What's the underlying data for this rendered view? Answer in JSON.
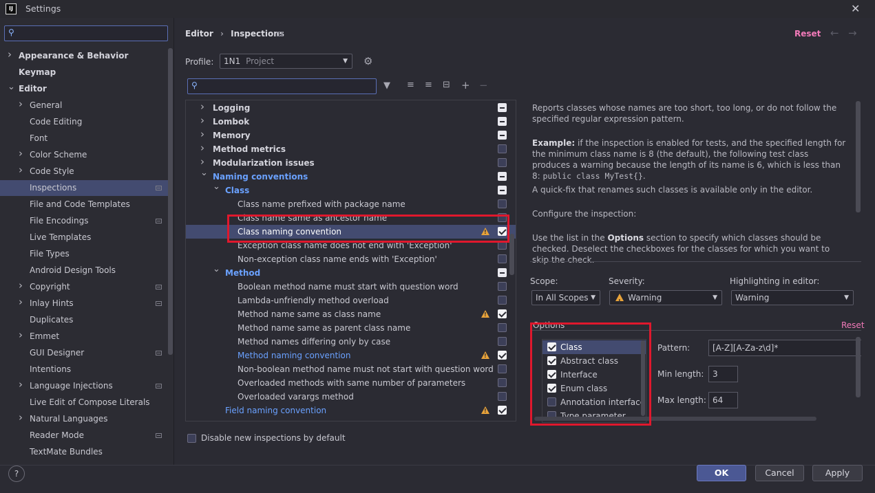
{
  "window": {
    "title": "Settings",
    "app_logo": "IJ"
  },
  "sidebar": {
    "search_placeholder": "",
    "items": [
      {
        "label": "Appearance & Behavior",
        "bold": true,
        "chevron": "right",
        "indent": 0
      },
      {
        "label": "Keymap",
        "bold": true,
        "chevron": "",
        "indent": 0
      },
      {
        "label": "Editor",
        "bold": true,
        "chevron": "down",
        "indent": 0
      },
      {
        "label": "General",
        "chevron": "right",
        "indent": 1
      },
      {
        "label": "Code Editing",
        "indent": 1
      },
      {
        "label": "Font",
        "indent": 1
      },
      {
        "label": "Color Scheme",
        "chevron": "right",
        "indent": 1
      },
      {
        "label": "Code Style",
        "chevron": "right",
        "indent": 1
      },
      {
        "label": "Inspections",
        "indent": 1,
        "selected": true,
        "gear": true
      },
      {
        "label": "File and Code Templates",
        "indent": 1
      },
      {
        "label": "File Encodings",
        "indent": 1,
        "gear": true
      },
      {
        "label": "Live Templates",
        "indent": 1
      },
      {
        "label": "File Types",
        "indent": 1
      },
      {
        "label": "Android Design Tools",
        "indent": 1
      },
      {
        "label": "Copyright",
        "chevron": "right",
        "indent": 1,
        "gear": true
      },
      {
        "label": "Inlay Hints",
        "chevron": "right",
        "indent": 1,
        "gear": true
      },
      {
        "label": "Duplicates",
        "indent": 1
      },
      {
        "label": "Emmet",
        "chevron": "right",
        "indent": 1
      },
      {
        "label": "GUI Designer",
        "indent": 1,
        "gear": true
      },
      {
        "label": "Intentions",
        "indent": 1
      },
      {
        "label": "Language Injections",
        "chevron": "right",
        "indent": 1,
        "gear": true
      },
      {
        "label": "Live Edit of Compose Literals",
        "indent": 1
      },
      {
        "label": "Natural Languages",
        "chevron": "right",
        "indent": 1
      },
      {
        "label": "Reader Mode",
        "indent": 1,
        "gear": true
      },
      {
        "label": "TextMate Bundles",
        "indent": 1
      }
    ]
  },
  "header": {
    "breadcrumb_root": "Editor",
    "breadcrumb_sep": "›",
    "breadcrumb_current": "Inspections",
    "reset_label": "Reset",
    "back_icon": "arrow-left-icon",
    "forward_icon": "arrow-right-icon"
  },
  "profile": {
    "label": "Profile:",
    "name": "1N1",
    "scope": "Project"
  },
  "inspections": {
    "search_placeholder": "",
    "rows": [
      {
        "label": "Logging",
        "level": 0,
        "chevron": "right",
        "bold": true,
        "check": "mixed"
      },
      {
        "label": "Lombok",
        "level": 0,
        "chevron": "right",
        "bold": true,
        "check": "mixed"
      },
      {
        "label": "Memory",
        "level": 0,
        "chevron": "right",
        "bold": true,
        "check": "mixed"
      },
      {
        "label": "Method metrics",
        "level": 0,
        "chevron": "right",
        "bold": true,
        "check": "none"
      },
      {
        "label": "Modularization issues",
        "level": 0,
        "chevron": "right",
        "bold": true,
        "check": "none"
      },
      {
        "label": "Naming conventions",
        "level": 0,
        "chevron": "down",
        "bold": true,
        "blue": true,
        "check": "mixed"
      },
      {
        "label": "Class",
        "level": 1,
        "chevron": "down",
        "bold": true,
        "blue": true,
        "check": "mixed"
      },
      {
        "label": "Class name prefixed with package name",
        "level": 2,
        "check": "none"
      },
      {
        "label": "Class name same as ancestor name",
        "level": 2,
        "check": "none"
      },
      {
        "label": "Class naming convention",
        "level": 2,
        "check": "checked",
        "warn": true,
        "selected": true
      },
      {
        "label": "Exception class name does not end with 'Exception'",
        "level": 2,
        "check": "none"
      },
      {
        "label": "Non-exception class name ends with 'Exception'",
        "level": 2,
        "check": "none"
      },
      {
        "label": "Method",
        "level": 1,
        "chevron": "down",
        "bold": true,
        "blue": true,
        "check": "mixed"
      },
      {
        "label": "Boolean method name must start with question word",
        "level": 2,
        "check": "none"
      },
      {
        "label": "Lambda-unfriendly method overload",
        "level": 2,
        "check": "none"
      },
      {
        "label": "Method name same as class name",
        "level": 2,
        "check": "checked",
        "warn": true
      },
      {
        "label": "Method name same as parent class name",
        "level": 2,
        "check": "none"
      },
      {
        "label": "Method names differing only by case",
        "level": 2,
        "check": "none"
      },
      {
        "label": "Method naming convention",
        "level": 2,
        "check": "checked",
        "warn": true,
        "blue": true
      },
      {
        "label": "Non-boolean method name must not start with question word",
        "level": 2,
        "check": "none"
      },
      {
        "label": "Overloaded methods with same number of parameters",
        "level": 2,
        "check": "none"
      },
      {
        "label": "Overloaded varargs method",
        "level": 2,
        "check": "none"
      },
      {
        "label": "Field naming convention",
        "level": 1,
        "check": "checked",
        "warn": true,
        "blue": true
      }
    ],
    "footer_checkbox_label": "Disable new inspections by default"
  },
  "description": {
    "p1": "Reports classes whose names are too short, too long, or do not follow the specified regular expression pattern.",
    "p2_bold": "Example:",
    "p2": " if the inspection is enabled for tests, and the specified length for the minimum class name is 8 (the default), the following test class produces a warning because the length of its name is 6, which is less than 8: ",
    "p2_code": "public class MyTest{}",
    "p2_end": ".",
    "p3": "A quick-fix that renames such classes is available only in the editor.",
    "p4": "Configure the inspection:",
    "p5_a": "Use the list in the ",
    "p5_bold": "Options",
    "p5_b": " section to specify which classes should be checked. Deselect the checkboxes for the classes for which you want to skip the check."
  },
  "scope": {
    "label": "Scope:",
    "value": "In All Scopes"
  },
  "severity": {
    "label": "Severity:",
    "value": "Warning"
  },
  "highlighting": {
    "label": "Highlighting in editor:",
    "value": "Warning"
  },
  "options": {
    "title": "Options",
    "reset_label": "Reset",
    "list": [
      {
        "label": "Class",
        "checked": true,
        "selected": true
      },
      {
        "label": "Abstract class",
        "checked": true
      },
      {
        "label": "Interface",
        "checked": true
      },
      {
        "label": "Enum class",
        "checked": true
      },
      {
        "label": "Annotation interface",
        "checked": false
      },
      {
        "label": "Type parameter",
        "checked": false
      }
    ],
    "pattern_label": "Pattern:",
    "pattern_value": "[A-Z][A-Za-z\\d]*",
    "min_label": "Min length:",
    "min_value": "3",
    "max_label": "Max length:",
    "max_value": "64"
  },
  "buttons": {
    "ok": "OK",
    "cancel": "Cancel",
    "apply": "Apply",
    "help": "?"
  },
  "colors": {
    "accent": "#6aa1ff",
    "reset": "#f27ab9",
    "highlight_box": "#e0182d",
    "warning": "#e8a33a"
  }
}
